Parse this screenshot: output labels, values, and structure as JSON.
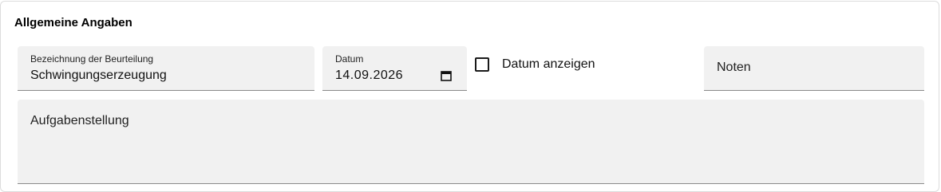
{
  "section": {
    "title": "Allgemeine Angaben"
  },
  "fields": {
    "bezeichnung": {
      "label": "Bezeichnung der Beurteilung",
      "value": "Schwingungserzeugung"
    },
    "datum": {
      "label": "Datum",
      "value": "14.09.2026",
      "icon": "calendar-icon"
    },
    "datum_anzeigen": {
      "label": "Datum anzeigen",
      "checked": false
    },
    "noten": {
      "label": "Noten"
    },
    "aufgabenstellung": {
      "label": "Aufgabenstellung"
    }
  }
}
